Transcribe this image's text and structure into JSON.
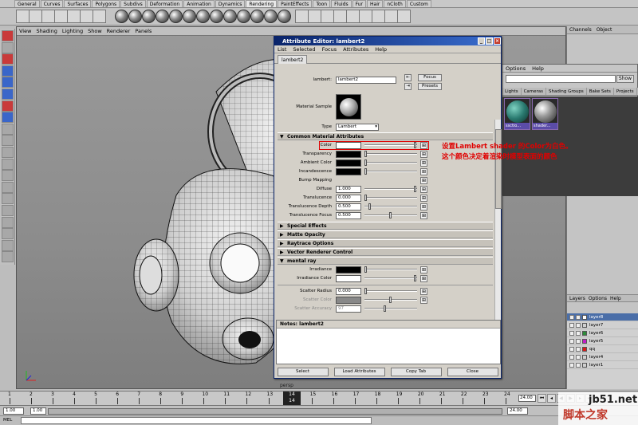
{
  "shelf_tabs": [
    "General",
    "Curves",
    "Surfaces",
    "Polygons",
    "Subdivs",
    "Deformation",
    "Animation",
    "Dynamics",
    "Rendering",
    "PaintEffects",
    "Toon",
    "Fluids",
    "Fur",
    "Hair",
    "nCloth",
    "Custom"
  ],
  "viewport_menu": [
    "View",
    "Shading",
    "Lighting",
    "Show",
    "Renderer",
    "Panels"
  ],
  "viewport_label": "persp",
  "attribute_editor": {
    "title": "Attribute Editor: lambert2",
    "menu": [
      "List",
      "Selected",
      "Focus",
      "Attributes",
      "Help"
    ],
    "tab": "lambert2",
    "node_label": "lambert:",
    "node_value": "lambert2",
    "focus_button": "Focus",
    "presets_button": "Presets",
    "material_sample_label": "Material Sample",
    "type_label": "Type",
    "type_value": "Lambert",
    "common_section": "Common Material Attributes",
    "attrs": {
      "color": "Color",
      "transparency": "Transparency",
      "ambient_color": "Ambient Color",
      "incandescence": "Incandescence",
      "bump_mapping": "Bump Mapping",
      "diffuse": "Diffuse",
      "diffuse_value": "1.000",
      "translucence": "Translucence",
      "translucence_value": "0.000",
      "translucence_depth": "Translucence Depth",
      "translucence_depth_value": "0.500",
      "translucence_focus": "Translucence Focus",
      "translucence_focus_value": "0.500"
    },
    "sections": [
      "Special Effects",
      "Matte Opacity",
      "Raytrace Options",
      "Vector Renderer Control"
    ],
    "mental_ray_section": "mental ray",
    "mental_ray": {
      "irradiance": "Irradiance",
      "irradiance_color": "Irradiance Color",
      "scatter_radius": "Scatter Radius",
      "scatter_radius_value": "0.000",
      "scatter_color": "Scatter Color",
      "scatter_accuracy": "Scatter Accuracy",
      "scatter_accuracy_value": "97"
    },
    "notes_header": "Notes:  lambert2",
    "buttons": {
      "select": "Select",
      "load_attributes": "Load Attributes",
      "copy_tab": "Copy Tab",
      "close": "Close"
    }
  },
  "hypershade": {
    "menu": [
      "Options",
      "Help"
    ],
    "show_button": "Show",
    "tabs": [
      "Lights",
      "Cameras",
      "Shading Groups",
      "Bake Sets",
      "Projects",
      "Contrib"
    ],
    "swatches": [
      "ssctio...",
      "shader..."
    ]
  },
  "channel_box": {
    "menu": [
      "Channels",
      "Object"
    ]
  },
  "layers": {
    "menu": [
      "Layers",
      "Options",
      "Help"
    ],
    "items": [
      {
        "name": "layer8",
        "color": "#ffffff",
        "selected": true
      },
      {
        "name": "layer7",
        "color": "#d0d0d0",
        "selected": false
      },
      {
        "name": "layer6",
        "color": "#2e8b3a",
        "selected": false
      },
      {
        "name": "layer5",
        "color": "#c21ec9",
        "selected": false
      },
      {
        "name": "qq",
        "color": "#d91a1a",
        "selected": false
      },
      {
        "name": "layer4",
        "color": "#d0d0d0",
        "selected": false
      },
      {
        "name": "layer1",
        "color": "#d0d0d0",
        "selected": false
      }
    ]
  },
  "annotation": {
    "line1": "设置Lambert shader 的Color为白色。",
    "line2": "这个颜色决定着渲染时模型表面的颜色"
  },
  "timeline": {
    "ticks": [
      "1",
      "2",
      "3",
      "4",
      "5",
      "6",
      "7",
      "8",
      "9",
      "10",
      "11",
      "12",
      "13",
      "14",
      "15",
      "16",
      "17",
      "18",
      "19",
      "20",
      "21",
      "22",
      "23",
      "24"
    ],
    "current_frame": "14",
    "current_frame_small": "14",
    "end_time": "24.00"
  },
  "range": {
    "start": "1.00",
    "start2": "1.00",
    "end": "24.00"
  },
  "mel_label": "MEL",
  "watermark": {
    "site": "jb51.net",
    "cn": "脚本之家"
  },
  "colors": {
    "title_start": "#0a246a",
    "title_end": "#3a6ed0",
    "annotation": "#e00000",
    "swatch_label": "#5b4ca8"
  }
}
